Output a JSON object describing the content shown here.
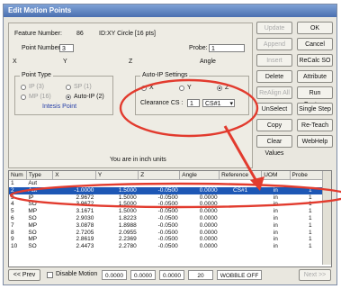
{
  "window": {
    "title": "Edit Motion Points"
  },
  "form": {
    "feature_number_label": "Feature Number:",
    "feature_number_value": "86",
    "feature_id": "ID:XY Circle [16 pts]",
    "point_number_label": "Point Number:",
    "point_number_value": "3",
    "probe_label": "Probe:",
    "probe_value": "1",
    "x_label": "X",
    "y_label": "Y",
    "z_label": "Z",
    "angle_label": "Angle",
    "units_text": "You are in inch units"
  },
  "point_type": {
    "title": "Point Type",
    "options": [
      {
        "label": "IP (3)",
        "selected": false,
        "enabled": false
      },
      {
        "label": "SP (1)",
        "selected": false,
        "enabled": false
      },
      {
        "label": "MP (16)",
        "selected": false,
        "enabled": false
      },
      {
        "label": "Auto-IP (2)",
        "selected": true,
        "enabled": true
      }
    ],
    "intesis_point": "Intesis Point"
  },
  "auto_ip": {
    "title": "Auto-IP Settings",
    "axes": [
      {
        "label": "X",
        "selected": false
      },
      {
        "label": "Y",
        "selected": false
      },
      {
        "label": "Z",
        "selected": true
      }
    ],
    "clearance_label": "Clearance CS :",
    "clearance_value": "1",
    "cs_value": "CS#1"
  },
  "buttons": {
    "update": "Update",
    "ok": "OK",
    "append": "Append",
    "cancel": "Cancel",
    "insert": "Insert",
    "recalc": "ReCalc SO",
    "delete": "Delete",
    "attribute": "Attribute",
    "realign": "ReAlign All",
    "run_feature": "Run Feature",
    "unselect": "UnSelect",
    "single_step": "Single Step",
    "copy": "Copy",
    "reteach": "Re-Teach",
    "clear_values": "Clear Values",
    "webhelp": "WebHelp"
  },
  "table": {
    "headers": [
      "Num",
      "Type",
      "X",
      "Y",
      "Z",
      "Angle",
      "Reference",
      "UOM",
      "Probe"
    ],
    "rows": [
      [
        "1",
        "Aut",
        "",
        "",
        "",
        "",
        "",
        "",
        ""
      ],
      [
        "2",
        "Aut",
        "-1.0000",
        "1.5000",
        "-0.0500",
        "0.0000",
        "CS#1",
        "in",
        "1"
      ],
      [
        "3",
        "IP",
        "2.9672",
        "1.5000",
        "-0.0500",
        "0.0000",
        "",
        "in",
        "1"
      ],
      [
        "4",
        "SO",
        "3.9672",
        "1.5000",
        "-0.0500",
        "0.0000",
        "",
        "in",
        "1"
      ],
      [
        "5",
        "MP",
        "3.1671",
        "1.5000",
        "-0.0500",
        "0.0000",
        "",
        "in",
        "1"
      ],
      [
        "6",
        "SO",
        "2.9030",
        "1.8223",
        "-0.0500",
        "0.0000",
        "",
        "in",
        "1"
      ],
      [
        "7",
        "MP",
        "3.0878",
        "1.8988",
        "-0.0500",
        "0.0000",
        "",
        "in",
        "1"
      ],
      [
        "8",
        "SO",
        "2.7205",
        "2.0955",
        "-0.0500",
        "0.0000",
        "",
        "in",
        "1"
      ],
      [
        "9",
        "MP",
        "2.8619",
        "2.2369",
        "-0.0500",
        "0.0000",
        "",
        "in",
        "1"
      ],
      [
        "10",
        "SO",
        "2.4473",
        "2.2780",
        "-0.0500",
        "0.0000",
        "",
        "in",
        "1"
      ]
    ],
    "selected_row": 1
  },
  "footer": {
    "prev": "<< Prev",
    "disable_motion": "Disable Motion",
    "v1": "0.0000",
    "v2": "0.0000",
    "v3": "0.0000",
    "v4": "20",
    "wobble": "WOBBLE OFF",
    "next": "Next >>"
  },
  "annotation_color": "#e23b2e"
}
